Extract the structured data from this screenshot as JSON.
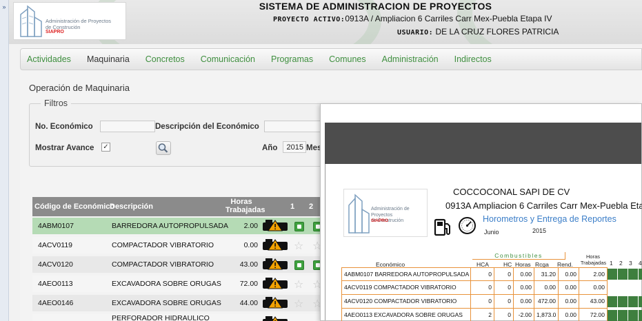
{
  "app": {
    "title": "SISTEMA DE ADMINISTRACION DE PROYECTOS",
    "project_label": "PROYECTO ACTIVO:",
    "project_value": "0913A / Ampliacion 6 Carriles Carr Mex-Puebla Etapa IV",
    "user_label": "USUARIO:",
    "user_value": "DE LA CRUZ FLORES PATRICIA",
    "logo_line1": "Administración de Proyectos",
    "logo_line2": "de Construción",
    "logo_brand": "SIAPRO"
  },
  "nav": {
    "items": [
      "Actividades",
      "Maquinaria",
      "Concretos",
      "Comunicación",
      "Programas",
      "Comunes",
      "Administración",
      "Indirectos"
    ],
    "active": "Maquinaria"
  },
  "page": {
    "title": "Operación de Maquinaria"
  },
  "filters": {
    "legend": "Filtros",
    "no_economico_label": "No. Económico",
    "no_economico_value": "",
    "descripcion_label": "Descripción del Económico",
    "descripcion_value": "",
    "mostrar_avance_label": "Mostrar Avance",
    "mostrar_avance_checked": true,
    "anio_label": "Año",
    "anio_value": "2015",
    "mes_label": "Mes"
  },
  "grid": {
    "headers": {
      "codigo": "Código de Económico",
      "descripcion": "Descripción",
      "horas_line1": "Horas",
      "horas_line2": "Trabajadas",
      "d1": "1",
      "d2": "2"
    },
    "rows": [
      {
        "codigo": "4ABM0107",
        "descripcion": "BARREDORA AUTOPROPULSADA",
        "horas": "2.00",
        "day1": "badge",
        "day2": "badge",
        "selected": true
      },
      {
        "codigo": "4ACV0119",
        "descripcion": "COMPACTADOR VIBRATORIO",
        "horas": "0.00",
        "day1": "star",
        "day2": "star",
        "selected": false
      },
      {
        "codigo": "4ACV0120",
        "descripcion": "COMPACTADOR VIBRATORIO",
        "horas": "43.00",
        "day1": "badge",
        "day2": "badge",
        "selected": false
      },
      {
        "codigo": "4AEO0113",
        "descripcion": "EXCAVADORA SOBRE ORUGAS",
        "horas": "72.00",
        "day1": "star",
        "day2": "star",
        "selected": false
      },
      {
        "codigo": "4AEO0146",
        "descripcion": "EXCAVADORA SOBRE ORUGAS",
        "horas": "44.00",
        "day1": "star",
        "day2": "star",
        "selected": false
      },
      {
        "codigo": "",
        "descripcion": "PERFORADOR HIDRAULICO",
        "horas": "",
        "day1": "",
        "day2": "",
        "selected": false
      }
    ]
  },
  "report": {
    "company": "COCCOCONAL SAPI DE CV",
    "project": "0913A Ampliacion 6 Carriles Carr Mex-Puebla Etapa IV",
    "subtitle": "Horometros y Entrega de Reportes",
    "month": "Junio",
    "year": "2015",
    "combustibles_label": "Combustibles",
    "horas_label_1": "Horas",
    "horas_label_2": "Trabajadas",
    "columns": [
      "Económico",
      "HCA",
      "HC",
      "Horas",
      "Rcga",
      "Rend."
    ],
    "day_columns": [
      "1",
      "2",
      "3",
      "4"
    ],
    "rows": [
      {
        "economico": "4ABM0107",
        "desc": "BARREDORA AUTOPROPULSADA",
        "hca": "0",
        "hc": "0",
        "horas": "0.00",
        "rcga": "31.20",
        "rend": "0.00",
        "trab": "2.00",
        "green": [
          1,
          1,
          1,
          1
        ]
      },
      {
        "economico": "4ACV0119",
        "desc": "COMPACTADOR VIBRATORIO",
        "hca": "0",
        "hc": "0",
        "horas": "0.00",
        "rcga": "0.00",
        "rend": "0.00",
        "trab": "0.00",
        "green": [
          0,
          0,
          0,
          0
        ]
      },
      {
        "economico": "4ACV0120",
        "desc": "COMPACTADOR VIBRATORIO",
        "hca": "0",
        "hc": "0",
        "horas": "0.00",
        "rcga": "472.00",
        "rend": "0.00",
        "trab": "43.00",
        "green": [
          1,
          1,
          1,
          1
        ]
      },
      {
        "economico": "4AEO0113",
        "desc": "EXCAVADORA SOBRE ORUGAS",
        "hca": "2",
        "hc": "0",
        "horas": "-2.00",
        "rcga": "1,873.0",
        "rend": "0.00",
        "trab": "72.00",
        "green": [
          1,
          1,
          1,
          1
        ]
      }
    ]
  },
  "colors": {
    "nav_text": "#3f8f3f",
    "selected_row": "#b5dbb5",
    "grid_header": "#8b8b8b",
    "report_border": "#e8923a",
    "report_green": "#3e7f3e",
    "report_subtitle": "#3b7ec8"
  },
  "icons": {
    "truck": "machine-operating-icon",
    "badge": "report-delivered-icon",
    "star": "empty-star-icon",
    "search": "magnifier-icon",
    "pump": "fuel-pump-icon",
    "gauge": "hour-meter-gauge-icon",
    "collapse": "expand-arrows-icon"
  }
}
